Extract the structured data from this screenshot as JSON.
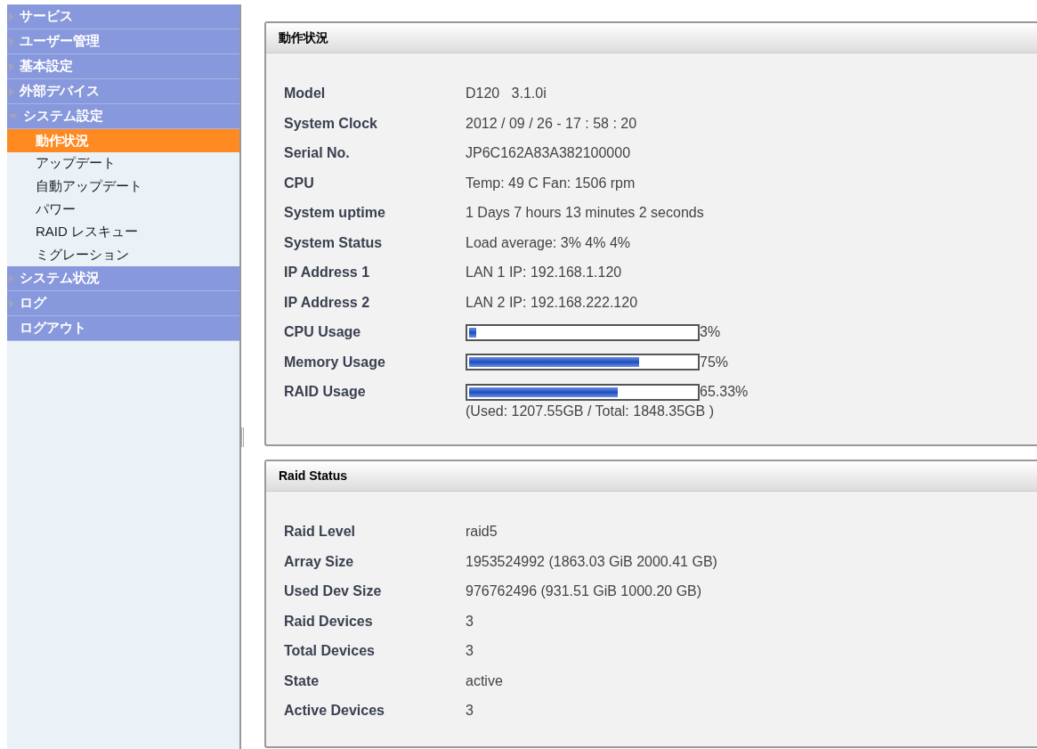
{
  "sidebar": {
    "items": [
      {
        "label": "サービス",
        "has_children": true,
        "expanded": false
      },
      {
        "label": "ユーザー管理",
        "has_children": true,
        "expanded": false
      },
      {
        "label": "基本設定",
        "has_children": true,
        "expanded": false
      },
      {
        "label": "外部デバイス",
        "has_children": true,
        "expanded": false
      },
      {
        "label": "システム設定",
        "has_children": true,
        "expanded": true,
        "children": [
          {
            "label": "動作状況",
            "selected": true
          },
          {
            "label": "アップデート",
            "selected": false
          },
          {
            "label": "自動アップデート",
            "selected": false
          },
          {
            "label": "パワー",
            "selected": false
          },
          {
            "label": "RAID レスキュー",
            "selected": false
          },
          {
            "label": "ミグレーション",
            "selected": false
          }
        ]
      },
      {
        "label": "システム状況",
        "has_children": true,
        "expanded": false
      },
      {
        "label": "ログ",
        "has_children": true,
        "expanded": false
      },
      {
        "label": "ログアウト",
        "has_children": false
      }
    ]
  },
  "panels": [
    {
      "title": "動作状況",
      "rows": [
        {
          "kind": "text",
          "label": "Model",
          "value": "D120   3.1.0i"
        },
        {
          "kind": "text",
          "label": "System Clock",
          "value": "2012 / 09 / 26 - 17 : 58 : 20"
        },
        {
          "kind": "text",
          "label": "Serial No.",
          "value": "JP6C162A83A382100000"
        },
        {
          "kind": "text",
          "label": "CPU",
          "value": "Temp: 49 C Fan: 1506 rpm"
        },
        {
          "kind": "text",
          "label": "System uptime",
          "value": "1 Days 7 hours 13 minutes 2 seconds"
        },
        {
          "kind": "text",
          "label": "System Status",
          "value": "Load average: 3% 4% 4%"
        },
        {
          "kind": "text",
          "label": "IP Address 1",
          "value": "LAN 1 IP: 192.168.1.120"
        },
        {
          "kind": "text",
          "label": "IP Address 2",
          "value": "LAN 2 IP: 192.168.222.120"
        },
        {
          "kind": "bar",
          "label": "CPU Usage",
          "level": 0.03,
          "reading": "3%"
        },
        {
          "kind": "bar",
          "label": "Memory Usage",
          "level": 0.75,
          "reading": "75%"
        },
        {
          "kind": "bar",
          "label": "RAID Usage",
          "level": 0.6533,
          "reading": "65.33%",
          "note": "(Used: 1207.55GB / Total: 1848.35GB )"
        }
      ]
    },
    {
      "title": "Raid Status",
      "rows": [
        {
          "kind": "text",
          "label": "Raid Level",
          "value": "raid5"
        },
        {
          "kind": "text",
          "label": "Array Size",
          "value": "1953524992 (1863.03 GiB 2000.41 GB)"
        },
        {
          "kind": "text",
          "label": "Used Dev Size",
          "value": "976762496 (931.51 GiB 1000.20 GB)"
        },
        {
          "kind": "text",
          "label": "Raid Devices",
          "value": "3"
        },
        {
          "kind": "text",
          "label": "Total Devices",
          "value": "3"
        },
        {
          "kind": "text",
          "label": "State",
          "value": "active"
        },
        {
          "kind": "text",
          "label": "Active Devices",
          "value": "3"
        }
      ]
    }
  ]
}
